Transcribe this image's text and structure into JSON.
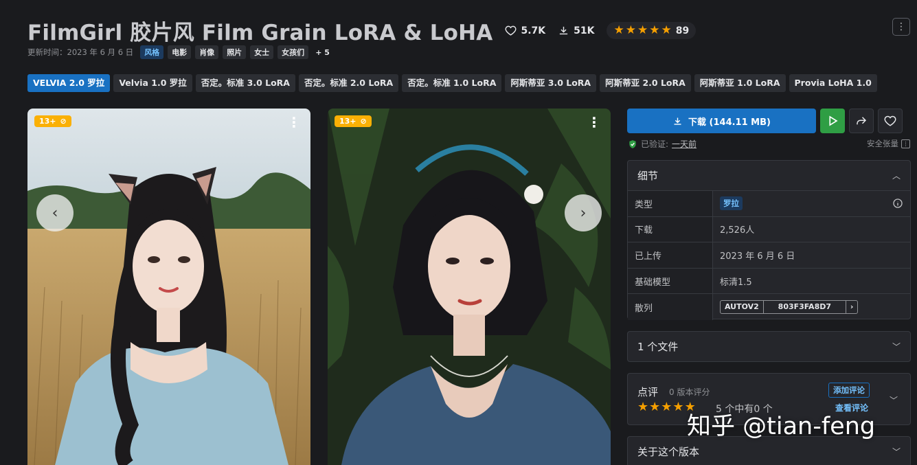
{
  "header": {
    "title": "FilmGirl 胶片风 Film Grain LoRA & LoHA",
    "likes": "5.7K",
    "downloads": "51K",
    "rating_count": "89",
    "updated_label": "更新时间：2023 年 6 月 6 日",
    "tags": [
      "风格",
      "电影",
      "肖像",
      "照片",
      "女士",
      "女孩们"
    ],
    "more_tags": "+ 5"
  },
  "versions": [
    "VELVIA 2.0 罗拉",
    "Velvia 1.0 罗拉",
    "否定。标准 3.0 LoRA",
    "否定。标准 2.0 LoRA",
    "否定。标准 1.0 LoRA",
    "阿斯蒂亚 3.0 LoRA",
    "阿斯蒂亚 2.0 LoRA",
    "阿斯蒂亚 1.0 LoRA",
    "Provia LoHA 1.0"
  ],
  "gallery": {
    "badge_1": "13+",
    "badge_2": "13+"
  },
  "download": {
    "label": "下载 (144.11 MB)",
    "verified_label": "已验证:",
    "verified_ago": "一天前",
    "safetensor_label": "安全张量"
  },
  "details": {
    "title": "细节",
    "rows": [
      {
        "key": "类型",
        "value": "罗拉"
      },
      {
        "key": "下载",
        "value": "2,526人"
      },
      {
        "key": "已上传",
        "value": "2023 年 6 月 6 日"
      },
      {
        "key": "基础模型",
        "value": "标清1.5"
      },
      {
        "key": "散列",
        "hash_type": "AUTOV2",
        "hash_value": "803F3FA8D7"
      }
    ]
  },
  "files": {
    "label": "1 个文件"
  },
  "reviews": {
    "title": "点评",
    "version_count": "0 版本评分",
    "out_of": "5 个中有0 个",
    "add_label": "添加评论",
    "see_label": "查看评论"
  },
  "about": {
    "label": "关于这个版本"
  },
  "watermark": "知乎 @tian-feng",
  "colors": {
    "accent": "#1971c2",
    "play": "#2f9e44",
    "star": "#f59f00",
    "nsfw_badge": "#fab005",
    "background": "#1a1b1e"
  }
}
